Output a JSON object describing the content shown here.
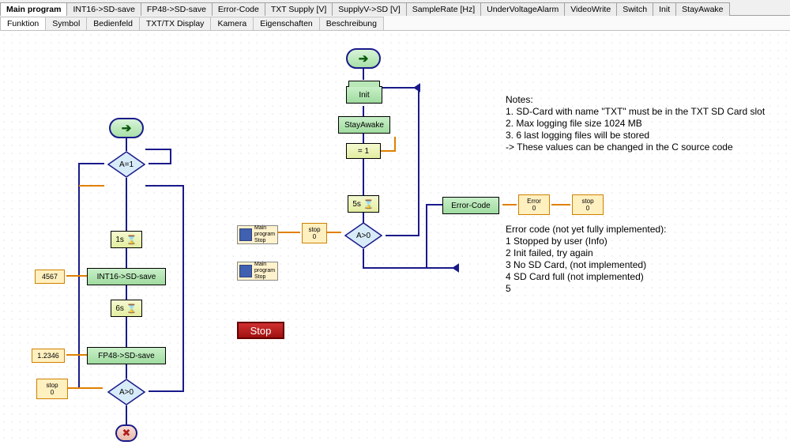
{
  "tabs": {
    "items": [
      {
        "label": "Main program",
        "active": true
      },
      {
        "label": "INT16->SD-save"
      },
      {
        "label": "FP48->SD-save"
      },
      {
        "label": "Error-Code"
      },
      {
        "label": "TXT Supply [V]"
      },
      {
        "label": "SupplyV->SD [V]"
      },
      {
        "label": "SampleRate [Hz]"
      },
      {
        "label": "UnderVoltageAlarm"
      },
      {
        "label": "VideoWrite"
      },
      {
        "label": "Switch"
      },
      {
        "label": "Init"
      },
      {
        "label": "StayAwake"
      }
    ]
  },
  "subtabs": {
    "items": [
      {
        "label": "Funktion",
        "active": true
      },
      {
        "label": "Symbol"
      },
      {
        "label": "Bedienfeld"
      },
      {
        "label": "TXT/TX Display"
      },
      {
        "label": "Kamera"
      },
      {
        "label": "Eigenschaften"
      },
      {
        "label": "Beschreibung"
      }
    ]
  },
  "blocks": {
    "init": "Init",
    "stayawake": "StayAwake",
    "eq1": "=   1",
    "wait5s": "5s",
    "wait1s": "1s",
    "wait6s": "6s",
    "diag_a1": "A=1",
    "diag_a0a": "A>0",
    "diag_a0b": "A>0",
    "int16save": "INT16->SD-save",
    "fp48save": "FP48->SD-save",
    "errorcode": "Error-Code",
    "const4567": "4567",
    "const12346": "1.2346",
    "stop_small": "stop",
    "stop_small_0": "0",
    "error_lbl": "Error",
    "error_0": "0",
    "miniprog": "Main program",
    "miniprog_stop": "Stop",
    "stop_btn": "Stop"
  },
  "notes": {
    "title": "Notes:",
    "n1": "1. SD-Card with name \"TXT\" must be in the TXT SD Card slot",
    "n2": "2. Max logging file size 1024 MB",
    "n3": "3. 6 last logging files will be stored",
    "n4": "-> These values can be changed in the C source code",
    "etitle": "Error code (not yet fully implemented):",
    "e1": "1 Stopped by user (Info)",
    "e2": "2 Init failed, try again",
    "e3": "3 No SD Card, (not implemented)",
    "e4": "4 SD Card full (not implemented)",
    "e5": "5"
  }
}
